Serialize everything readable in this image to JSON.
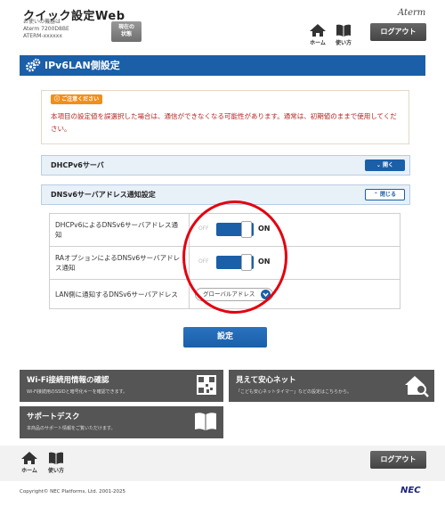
{
  "header": {
    "app_title": "クイック設定Web",
    "device_lines": [
      "お使いの機器は",
      "Aterm 7200D8BE",
      "ATERM-xxxxxx"
    ],
    "status_label_1": "現在の",
    "status_label_2": "状態",
    "brand": "Aterm",
    "home_label": "ホーム",
    "help_label": "使い方",
    "logout_label": "ログアウト"
  },
  "section": {
    "title": "IPv6LAN側設定",
    "caution_badge": "ご注意ください",
    "caution_text": "本項目の設定値を誤選択した場合は、通信ができなくなる可能性があります。通常は、初期値のままで使用してください。"
  },
  "accordions": [
    {
      "title": "DHCPv6サーバ",
      "button": "開く"
    },
    {
      "title": "DNSv6サーバアドレス通知設定",
      "button": "閉じる"
    }
  ],
  "settings": [
    {
      "label": "DHCPv6によるDNSv6サーバアドレス通知",
      "off": "OFF",
      "on": "ON"
    },
    {
      "label": "RAオプションによるDNSv6サーバアドレス通知",
      "off": "OFF",
      "on": "ON"
    },
    {
      "label": "LAN側に通知するDNSv6サーバアドレス",
      "select_value": "グローバルアドレス"
    }
  ],
  "submit_label": "設定",
  "cards": [
    {
      "title": "Wi-Fi接続用情報の確認",
      "sub": "Wi-Fi接続用のSSIDと暗号化キーを確認できます。"
    },
    {
      "title": "見えて安心ネット",
      "sub": "「こども安心ネットタイマー」などの設定はこちらから。"
    },
    {
      "title": "サポートデスク",
      "sub": "本商品のサポート情報をご覧いただけます。"
    }
  ],
  "footer": {
    "home_label": "ホーム",
    "help_label": "使い方",
    "logout_label": "ログアウト",
    "copyright": "Copyright© NEC Platforms, Ltd. 2001-2025",
    "maker": "NEC"
  },
  "colors": {
    "primary": "#1a5fa8",
    "caution": "#f08f1a",
    "highlight_ring": "#e3000f"
  }
}
